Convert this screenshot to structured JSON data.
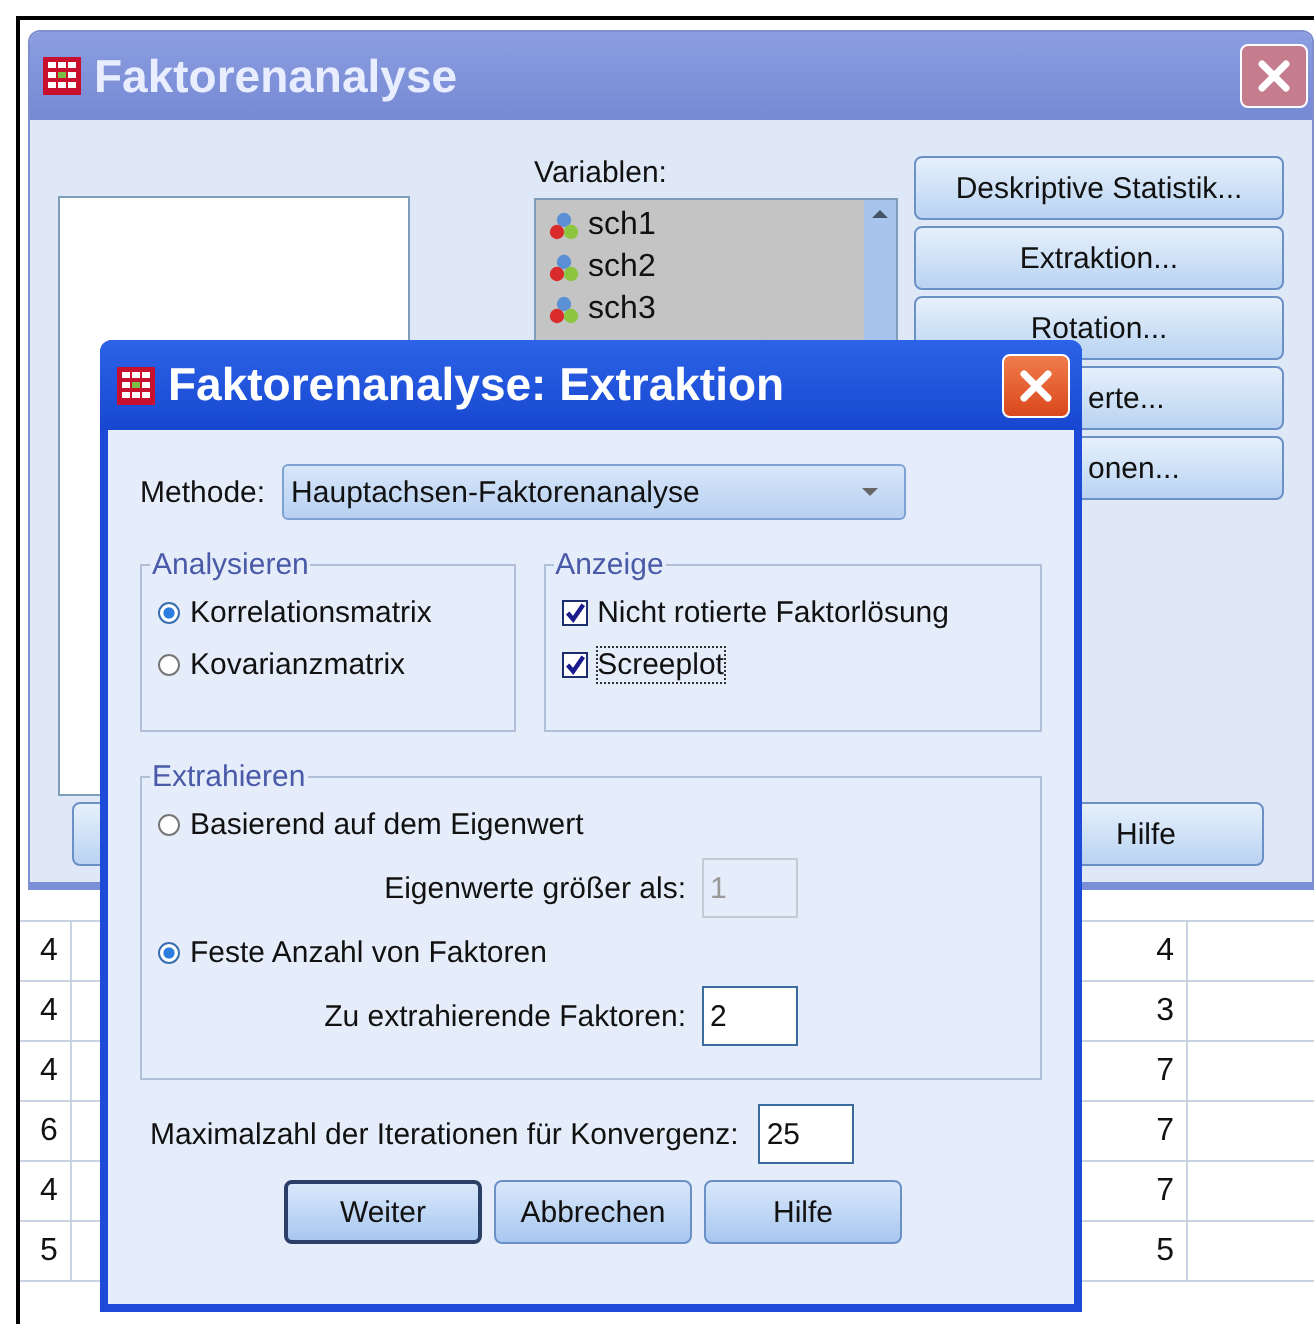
{
  "main_window": {
    "title": "Faktorenanalyse",
    "variables_label": "Variablen:",
    "variables": [
      "sch1",
      "sch2",
      "sch3"
    ],
    "buttons": [
      "Deskriptive Statistik...",
      "Extraktion...",
      "Rotation...",
      "erte...",
      "onen..."
    ],
    "help_button": "Hilfe"
  },
  "data_grid": {
    "rows": [
      [
        "4",
        "4"
      ],
      [
        "4",
        "3"
      ],
      [
        "4",
        "7"
      ],
      [
        "6",
        "7"
      ],
      [
        "4",
        "7"
      ],
      [
        "5",
        "5"
      ]
    ]
  },
  "dialog": {
    "title": "Faktorenanalyse: Extraktion",
    "method_label": "Methode:",
    "method_value": "Hauptachsen-Faktorenanalyse",
    "analyze": {
      "title": "Analysieren",
      "options": [
        {
          "label": "Korrelationsmatrix",
          "selected": true
        },
        {
          "label": "Kovarianzmatrix",
          "selected": false
        }
      ]
    },
    "display": {
      "title": "Anzeige",
      "options": [
        {
          "label": "Nicht rotierte Faktorlösung",
          "checked": true,
          "focused": false
        },
        {
          "label": "Screeplot",
          "checked": true,
          "focused": true
        }
      ]
    },
    "extract": {
      "title": "Extrahieren",
      "options": [
        {
          "label": "Basierend auf dem Eigenwert",
          "selected": false,
          "field_label": "Eigenwerte größer als:",
          "field_value": "1",
          "field_disabled": true
        },
        {
          "label": "Feste Anzahl von Faktoren",
          "selected": true,
          "field_label": "Zu extrahierende Faktoren:",
          "field_value": "2",
          "field_disabled": false
        }
      ]
    },
    "iterations_label": "Maximalzahl der Iterationen für Konvergenz:",
    "iterations_value": "25",
    "buttons": [
      {
        "label": "Weiter",
        "default": true
      },
      {
        "label": "Abbrechen",
        "default": false
      },
      {
        "label": "Hilfe",
        "default": false
      }
    ]
  }
}
